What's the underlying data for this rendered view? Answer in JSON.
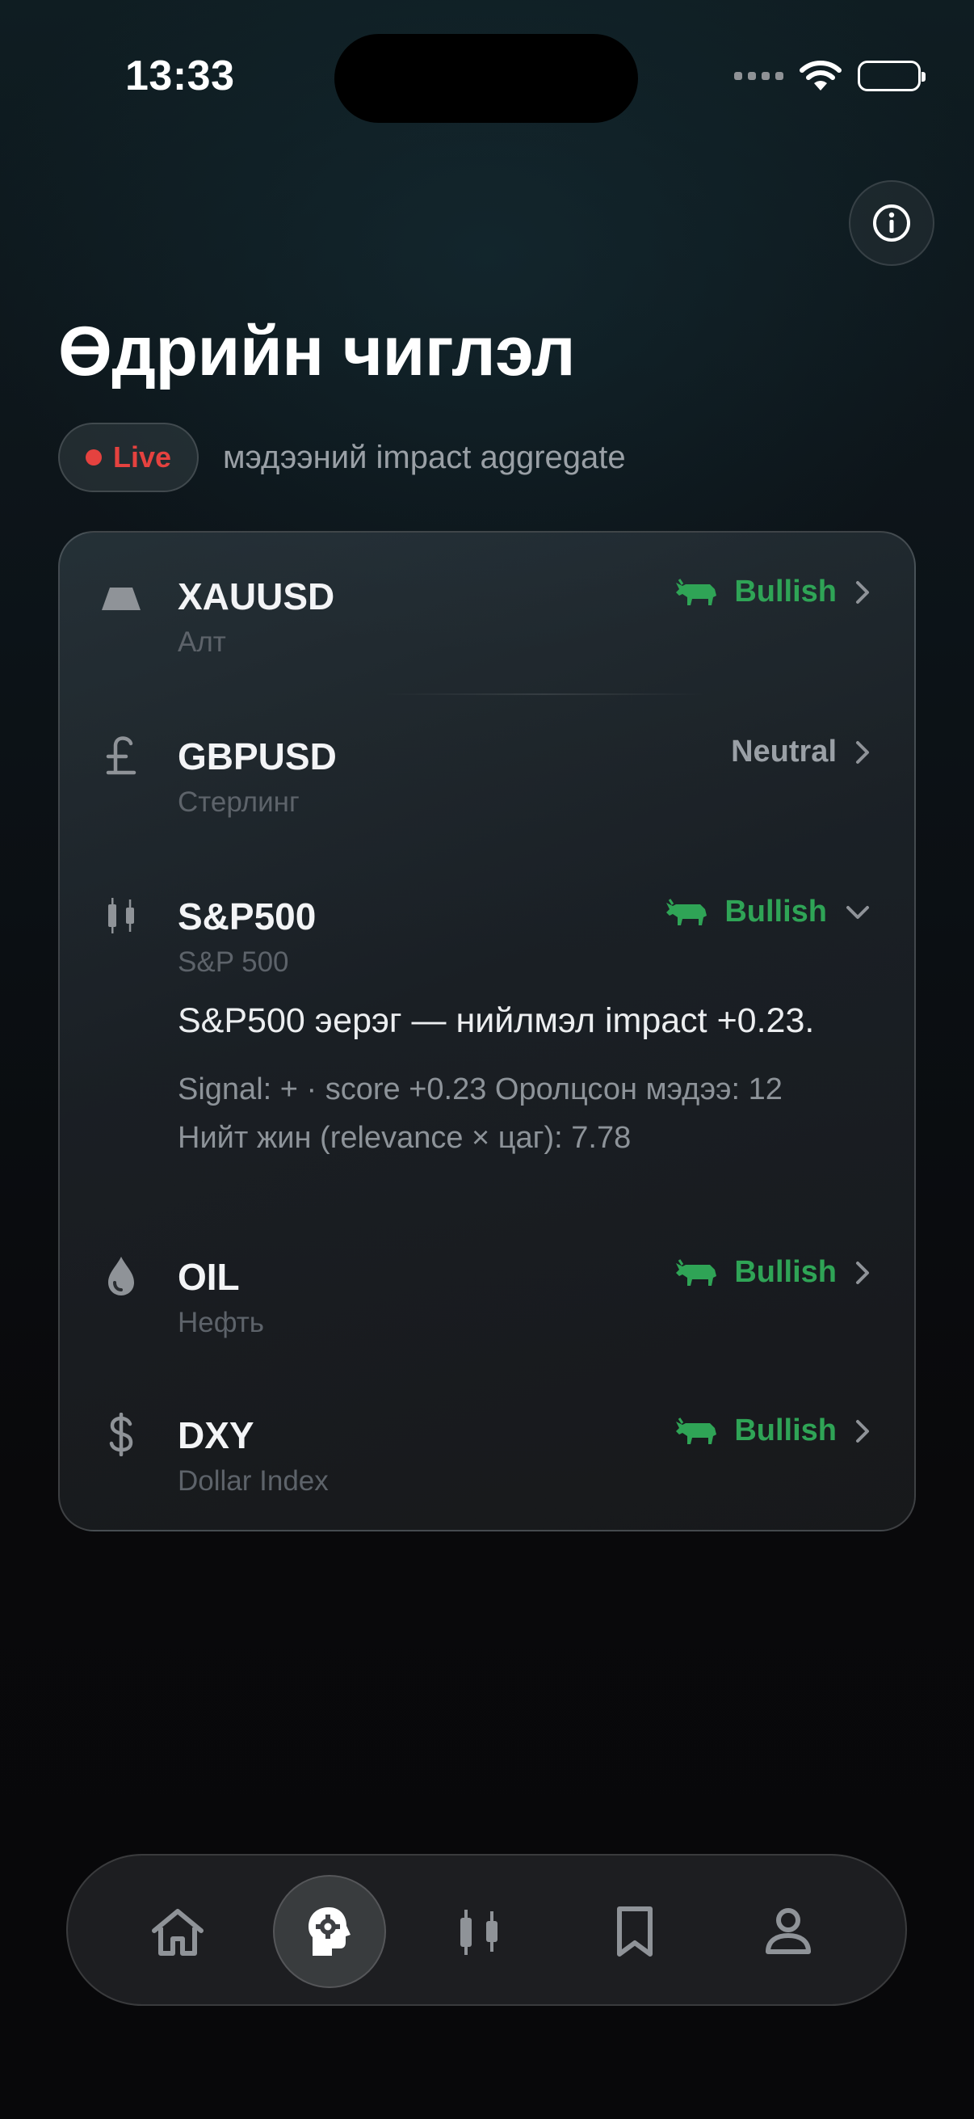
{
  "status_bar": {
    "time": "13:33",
    "signal_icon": "cellular-signal-icon",
    "wifi_icon": "wifi-icon",
    "battery_icon": "battery-icon"
  },
  "header": {
    "info_icon": "info-icon",
    "title": "Өдрийн чиглэл",
    "live_label": "Live",
    "subtitle": "мэдээний impact aggregate"
  },
  "colors": {
    "bullish": "#2fa456",
    "live": "#e5423f",
    "muted": "#9aa0a6"
  },
  "assets": [
    {
      "symbol": "XAUUSD",
      "name": "Алт",
      "icon": "gold-bar-icon",
      "sentiment": "Bullish",
      "expanded": false
    },
    {
      "symbol": "GBPUSD",
      "name": "Стерлинг",
      "icon": "pound-sign-icon",
      "sentiment": "Neutral",
      "expanded": false
    },
    {
      "symbol": "S&P500",
      "name": "S&P 500",
      "icon": "candlestick-icon",
      "sentiment": "Bullish",
      "expanded": true,
      "detail": {
        "headline": "S&P500 эерэг — нийлмэл impact +0.23.",
        "line1": "Signal: + · score +0.23 Оролцсон мэдээ: 12",
        "line2": "Нийт жин (relevance × цаг): 7.78"
      }
    },
    {
      "symbol": "OIL",
      "name": "Нефть",
      "icon": "oil-drop-icon",
      "sentiment": "Bullish",
      "expanded": false
    },
    {
      "symbol": "DXY",
      "name": "Dollar Index",
      "icon": "dollar-sign-icon",
      "sentiment": "Bullish",
      "expanded": false
    }
  ],
  "tab_bar": [
    {
      "icon": "home-icon",
      "active": false
    },
    {
      "icon": "brain-gear-icon",
      "active": true
    },
    {
      "icon": "candlestick-icon",
      "active": false
    },
    {
      "icon": "bookmark-icon",
      "active": false
    },
    {
      "icon": "profile-icon",
      "active": false
    }
  ]
}
